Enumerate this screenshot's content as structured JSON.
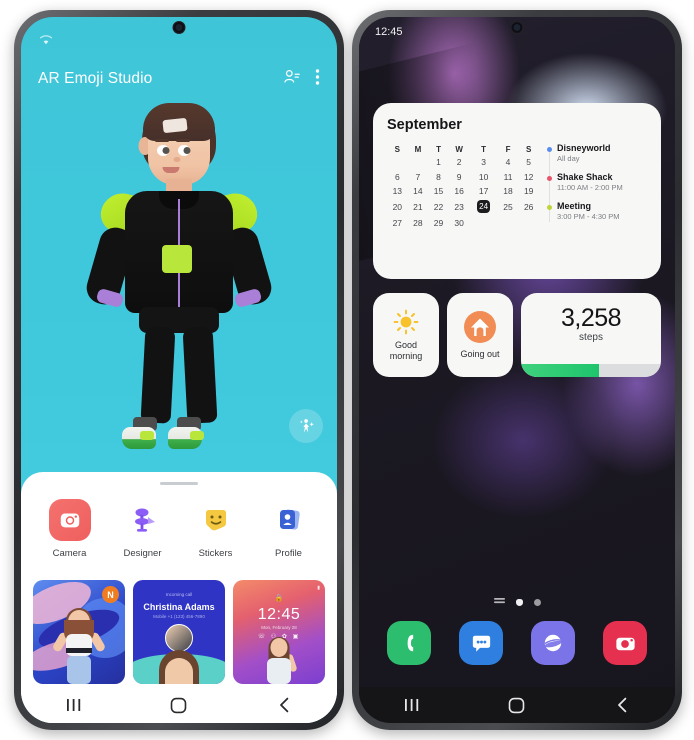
{
  "left_phone": {
    "status_bar": {
      "wifi_icon": "wifi-icon"
    },
    "header": {
      "title": "AR Emoji Studio",
      "contacts_icon": "person-list-icon",
      "overflow_icon": "more-vertical-icon"
    },
    "fab": {
      "icon": "person-sparkle-icon"
    },
    "apps": [
      {
        "label": "Camera",
        "icon": "camera-icon",
        "color": "#ef5f5e"
      },
      {
        "label": "Designer",
        "icon": "designer-icon",
        "color": "#8b5cf6"
      },
      {
        "label": "Stickers",
        "icon": "sticker-face-icon",
        "color": "#f5c842"
      },
      {
        "label": "Profile",
        "icon": "profile-card-icon",
        "color": "#3b62d4"
      }
    ],
    "cards": [
      {
        "name": "avatar-wallpaper-card",
        "badge": "N"
      },
      {
        "name": "contact-card",
        "subtitle": "Incoming call",
        "title": "Christina Adams",
        "meta": "Mobile  +1 (123) 456-7890"
      },
      {
        "name": "lock-screen-card",
        "lock_label": "Locked",
        "time": "12:45",
        "date": "Mon, February 28",
        "icons": "phone / wifi / camera"
      }
    ],
    "nav": {
      "recents": "recents-icon",
      "home": "home-icon",
      "back": "back-icon"
    }
  },
  "right_phone": {
    "status_bar": {
      "time": "12:45"
    },
    "calendar_widget": {
      "month": "September",
      "weekdays": [
        "S",
        "M",
        "T",
        "W",
        "T",
        "F",
        "S"
      ],
      "weeks": [
        [
          "",
          "",
          "1",
          "2",
          "3",
          "4",
          "5"
        ],
        [
          "6",
          "7",
          "8",
          "9",
          "10",
          "11",
          "12"
        ],
        [
          "13",
          "14",
          "15",
          "16",
          "17",
          "18",
          "19"
        ],
        [
          "20",
          "21",
          "22",
          "23",
          "24",
          "25",
          "26"
        ],
        [
          "27",
          "28",
          "29",
          "30",
          "",
          "",
          ""
        ]
      ],
      "today": "24",
      "events": [
        {
          "title": "Disneyworld",
          "time": "All day",
          "color": "#5b8dee"
        },
        {
          "title": "Shake Shack",
          "time": "11:00 AM - 2:00 PM",
          "color": "#e8546b"
        },
        {
          "title": "Meeting",
          "time": "3:00 PM - 4:30 PM",
          "color": "#c0d43a"
        }
      ]
    },
    "small_widgets": {
      "greeting": {
        "label": "Good\nmorning",
        "icon": "sun-icon",
        "color": "#f7c22b"
      },
      "routine": {
        "label": "Going out",
        "icon": "home-outline-icon",
        "color": "#f08c54"
      },
      "steps": {
        "count": "3,258",
        "unit": "steps",
        "progress": 56,
        "bar_color": "#1ec46b"
      }
    },
    "page_indicators": {
      "apps_icon": "apps-list-icon",
      "active": "home-dot",
      "inactive": "page-dot"
    },
    "dock": [
      {
        "name": "phone-app",
        "icon": "phone-icon",
        "color": "#2dbd6e"
      },
      {
        "name": "messages-app",
        "icon": "message-icon",
        "color": "#2f7fe0"
      },
      {
        "name": "internet-app",
        "icon": "internet-icon",
        "color": "#7b74e8"
      },
      {
        "name": "camera-app",
        "icon": "camera-icon",
        "color": "#e5304f"
      }
    ],
    "nav": {
      "recents": "recents-icon",
      "home": "home-icon",
      "back": "back-icon"
    }
  }
}
